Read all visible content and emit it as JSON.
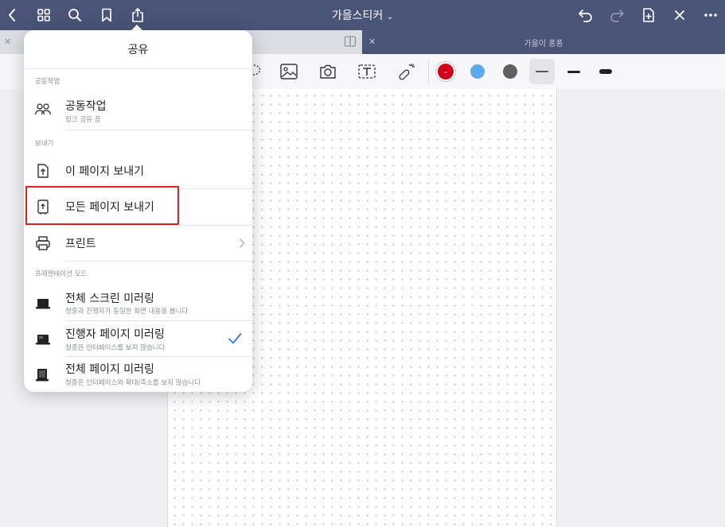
{
  "app": {
    "title": "가을스티커",
    "title_chevron": "⌄"
  },
  "tabs": [
    {
      "label": "",
      "active": true
    },
    {
      "label": "가을이 퐁퐁",
      "active": false
    }
  ],
  "toolbar": {
    "colors": [
      "#d0021b",
      "#5ca9f0",
      "#606060"
    ]
  },
  "share_popover": {
    "title": "공유",
    "sections": {
      "collab": "공동작업",
      "export": "보내기",
      "presentation": "프레젠테이션 모드"
    },
    "items": {
      "collab": {
        "label": "공동작업",
        "sub": "링크 공유 끔"
      },
      "export_page": {
        "label": "이 페이지 보내기"
      },
      "export_all": {
        "label": "모든 페이지 보내기"
      },
      "print": {
        "label": "프린트"
      },
      "mirror_screen": {
        "label": "전체 스크린 미러링",
        "sub": "청중과 진행자가 동일한 화면 내용을 봅니다"
      },
      "mirror_presenter": {
        "label": "진행자 페이지 미러링",
        "sub": "청중은 인터페이스를 보지 않습니다",
        "checked": true
      },
      "mirror_full_page": {
        "label": "전체 페이지 미러링",
        "sub": "청중은 인터페이스와 확대/축소를 보지 않습니다"
      }
    }
  },
  "colors": {
    "topbar": "#4a5478",
    "accent_check": "#2f7be0",
    "highlight": "#e0201f"
  }
}
